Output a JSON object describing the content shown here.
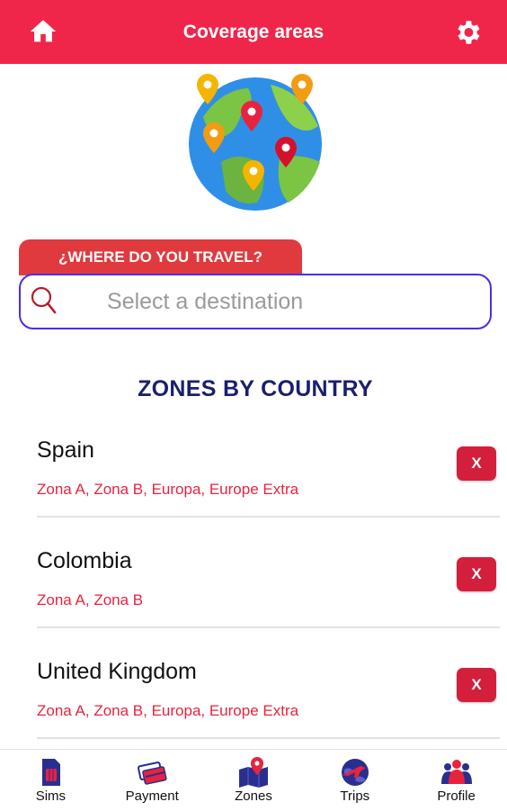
{
  "header": {
    "title": "Coverage areas",
    "left_icon": "home-icon",
    "right_icon": "gear-icon",
    "color": "#f0254a"
  },
  "search": {
    "tab_label": "¿WHERE DO YOU TRAVEL?",
    "placeholder": "Select a destination",
    "value": ""
  },
  "zones_section": {
    "title": "ZONES BY COUNTRY",
    "items": [
      {
        "country": "Spain",
        "zones": "Zona A, Zona B, Europa, Europe Extra",
        "remove_label": "X"
      },
      {
        "country": "Colombia",
        "zones": "Zona A, Zona B",
        "remove_label": "X"
      },
      {
        "country": "United Kingdom",
        "zones": "Zona A, Zona B, Europa, Europe Extra",
        "remove_label": "X"
      }
    ]
  },
  "bottom_nav": {
    "items": [
      {
        "label": "Sims",
        "icon": "sim-card-icon"
      },
      {
        "label": "Payment",
        "icon": "cards-icon"
      },
      {
        "label": "Zones",
        "icon": "map-pin-icon"
      },
      {
        "label": "Trips",
        "icon": "plane-globe-icon"
      },
      {
        "label": "Profile",
        "icon": "group-icon"
      }
    ]
  },
  "colors": {
    "accent_red": "#f0254a",
    "button_red": "#d31f3b",
    "zone_text": "#e8233e",
    "title_navy": "#1a1f6e",
    "search_border": "#4a2ee6"
  }
}
